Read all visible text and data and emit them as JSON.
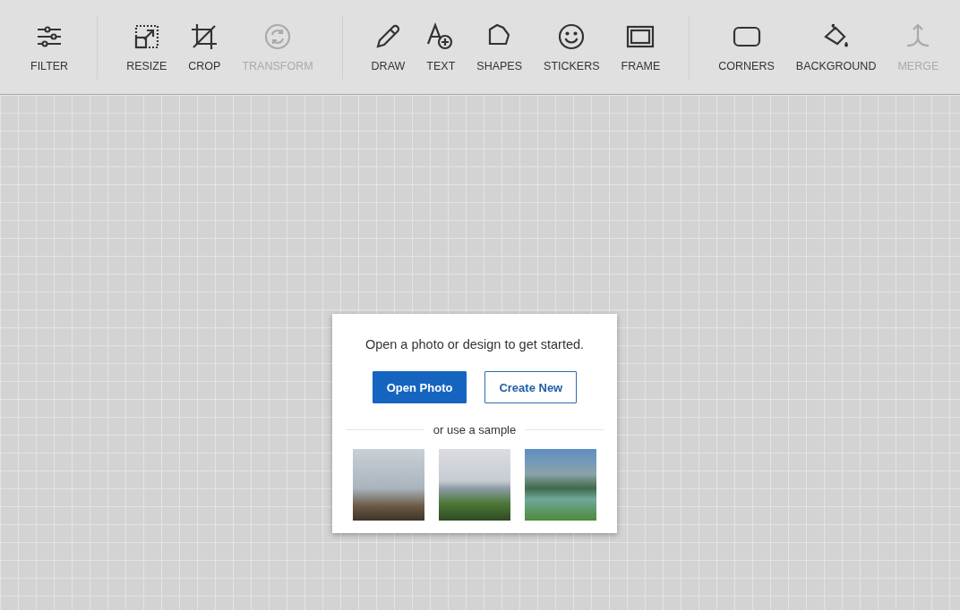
{
  "toolbar": {
    "groups": [
      {
        "tools": [
          {
            "label": "FILTER",
            "kind": "filter",
            "disabled": false
          }
        ]
      },
      {
        "tools": [
          {
            "label": "RESIZE",
            "kind": "resize",
            "disabled": false
          },
          {
            "label": "CROP",
            "kind": "crop",
            "disabled": false
          },
          {
            "label": "TRANSFORM",
            "kind": "transform",
            "disabled": true
          }
        ]
      },
      {
        "tools": [
          {
            "label": "DRAW",
            "kind": "draw",
            "disabled": false
          },
          {
            "label": "TEXT",
            "kind": "text",
            "disabled": false
          },
          {
            "label": "SHAPES",
            "kind": "shapes",
            "disabled": false
          },
          {
            "label": "STICKERS",
            "kind": "stickers",
            "disabled": false
          },
          {
            "label": "FRAME",
            "kind": "frame",
            "disabled": false
          }
        ]
      },
      {
        "tools": [
          {
            "label": "CORNERS",
            "kind": "corners",
            "disabled": false
          },
          {
            "label": "BACKGROUND",
            "kind": "background",
            "disabled": false
          },
          {
            "label": "MERGE",
            "kind": "merge",
            "disabled": true
          }
        ]
      }
    ]
  },
  "dialog": {
    "message": "Open a photo or design to get started.",
    "buttons": [
      {
        "label": "Open Photo",
        "kind": "primary"
      },
      {
        "label": "Create New",
        "kind": "outline"
      }
    ],
    "separator": "or use a sample",
    "samples": [
      {
        "kind": "mountain"
      },
      {
        "kind": "meadow"
      },
      {
        "kind": "lake"
      }
    ]
  }
}
